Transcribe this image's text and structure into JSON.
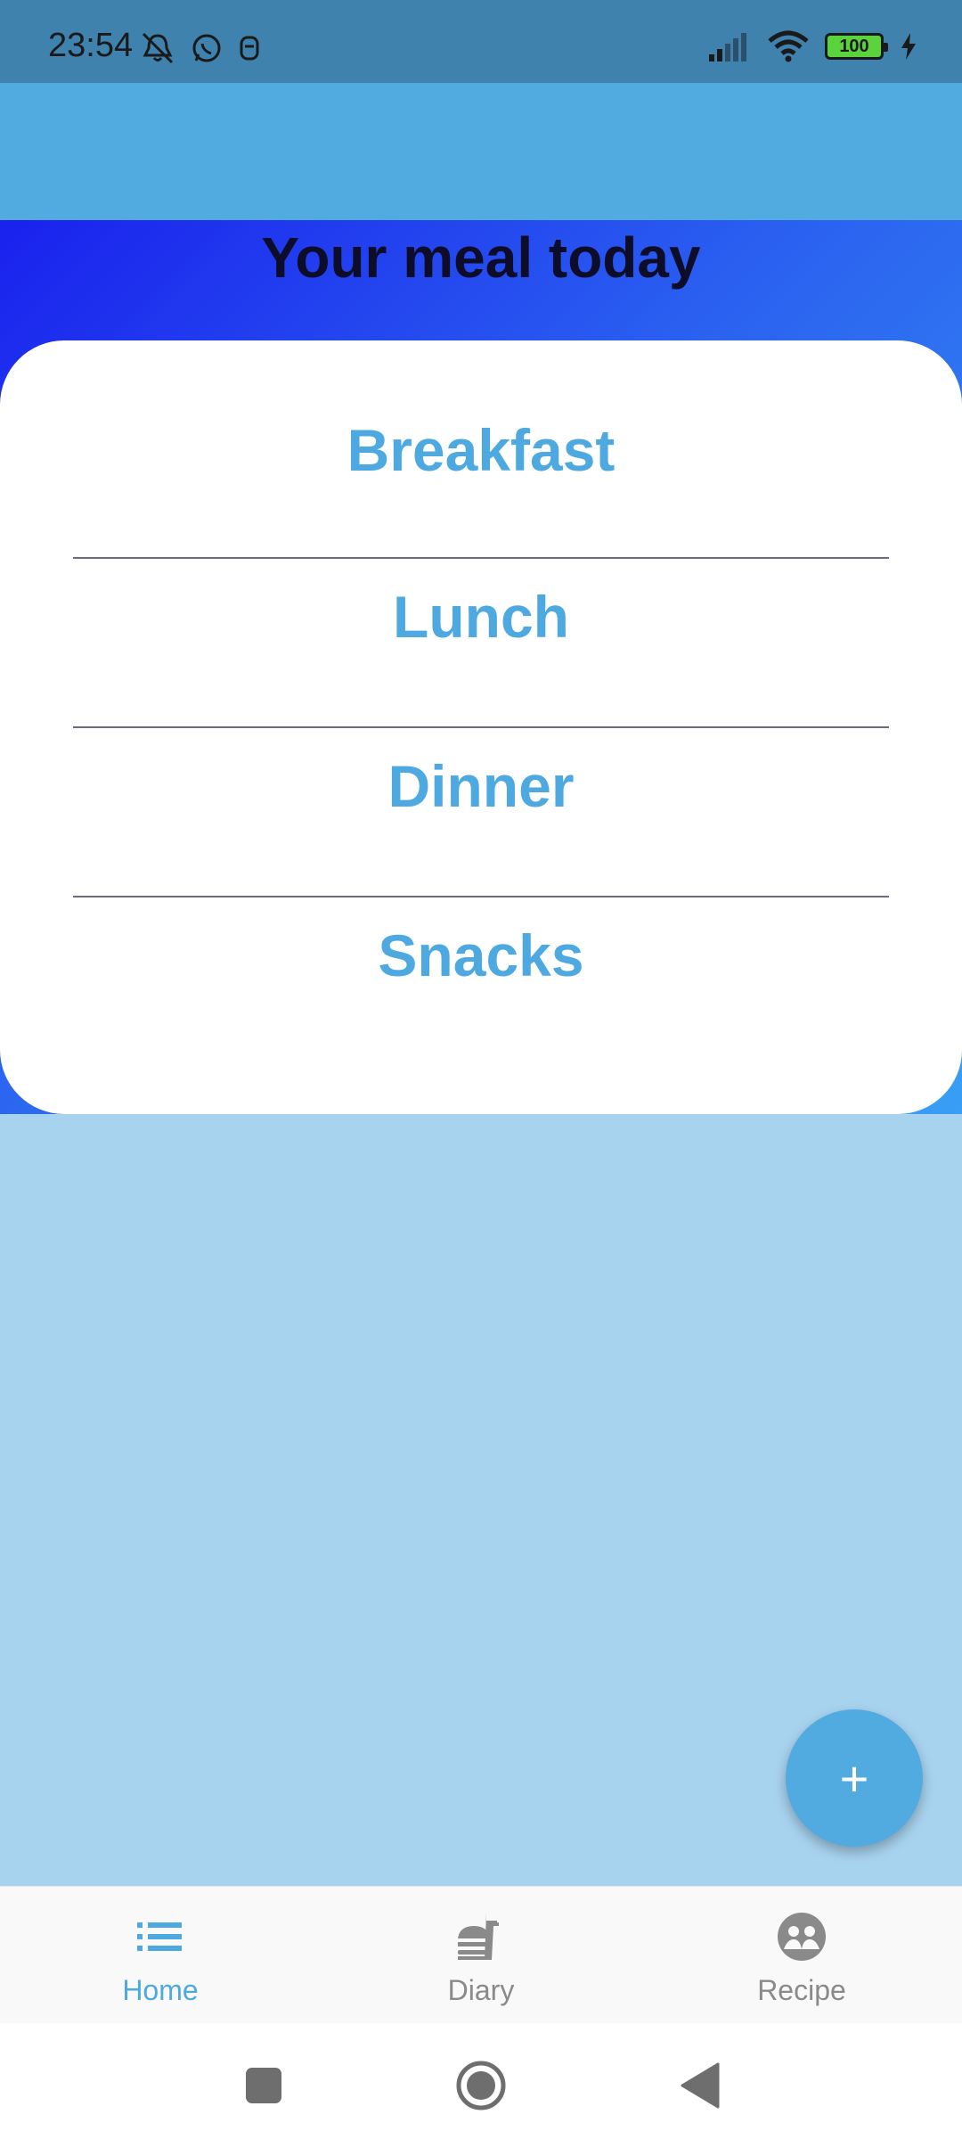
{
  "status_bar": {
    "time": "23:54",
    "battery": "100",
    "icons": [
      "mute-icon",
      "whatsapp-icon",
      "notification-app-icon",
      "signal-icon",
      "wifi-icon",
      "battery-icon",
      "charging-icon"
    ]
  },
  "header": {
    "title": "Your meal today"
  },
  "meals": [
    {
      "label": "Breakfast"
    },
    {
      "label": "Lunch"
    },
    {
      "label": "Dinner"
    },
    {
      "label": "Snacks"
    }
  ],
  "fab": {
    "label": "+"
  },
  "bottom_nav": {
    "items": [
      {
        "label": "Home",
        "icon": "list-icon",
        "active": true
      },
      {
        "label": "Diary",
        "icon": "fastfood-icon",
        "active": false
      },
      {
        "label": "Recipe",
        "icon": "group-recipe-icon",
        "active": false
      }
    ]
  },
  "system_nav": {
    "buttons": [
      "recents-button",
      "home-button",
      "back-button"
    ]
  },
  "colors": {
    "status_bar": "#3f82ad",
    "app_bar": "#52abe0",
    "accent": "#4ea9e1",
    "background": "#a8d3ef",
    "gradient_start": "#1a21ee",
    "gradient_end": "#389ff5"
  }
}
